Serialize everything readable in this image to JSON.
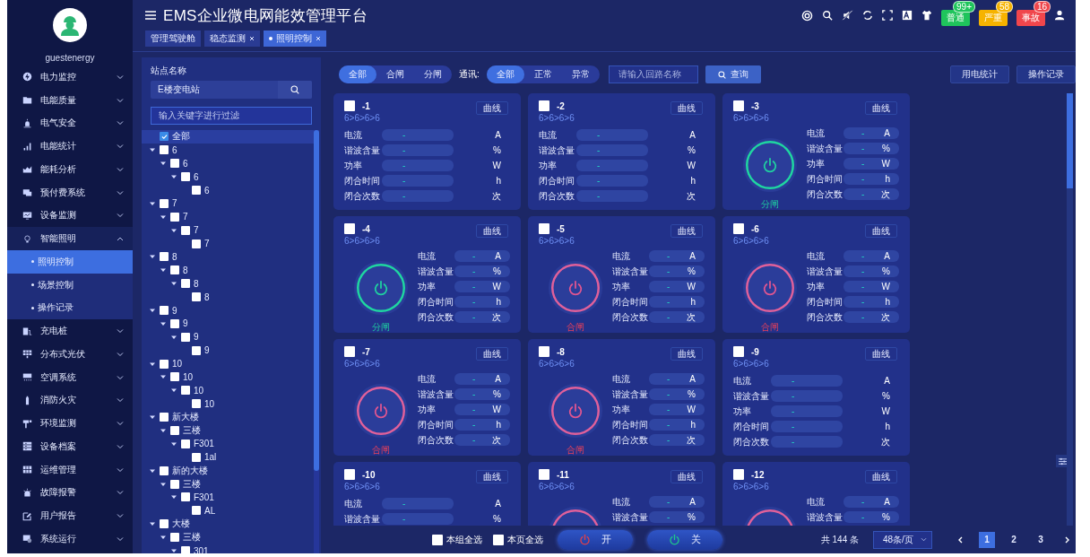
{
  "sidebar": {
    "username": "guestenergy",
    "items": [
      {
        "label": "电力监控",
        "expanded": false
      },
      {
        "label": "电能质量",
        "expanded": false
      },
      {
        "label": "电气安全",
        "expanded": false
      },
      {
        "label": "电能统计",
        "expanded": false
      },
      {
        "label": "能耗分析",
        "expanded": false
      },
      {
        "label": "预付费系统",
        "expanded": false
      },
      {
        "label": "设备监测",
        "expanded": false
      },
      {
        "label": "智能照明",
        "expanded": true,
        "children": [
          {
            "label": "照明控制",
            "selected": true
          },
          {
            "label": "场景控制",
            "selected": false
          },
          {
            "label": "操作记录",
            "selected": false
          }
        ]
      },
      {
        "label": "充电桩",
        "expanded": false
      },
      {
        "label": "分布式光伏",
        "expanded": false
      },
      {
        "label": "空调系统",
        "expanded": false
      },
      {
        "label": "消防火灾",
        "expanded": false
      },
      {
        "label": "环境监测",
        "expanded": false
      },
      {
        "label": "设备档案",
        "expanded": false
      },
      {
        "label": "运维管理",
        "expanded": false
      },
      {
        "label": "故障报警",
        "expanded": false
      },
      {
        "label": "用户报告",
        "expanded": false
      },
      {
        "label": "系统运行",
        "expanded": false
      }
    ]
  },
  "header": {
    "title": "EMS企业微电网能效管理平台",
    "alerts": [
      {
        "label": "普通",
        "count": "99+",
        "color": "#1fc45c"
      },
      {
        "label": "严重",
        "count": "58",
        "color": "#f6b300"
      },
      {
        "label": "事故",
        "count": "16",
        "color": "#f0464c"
      }
    ]
  },
  "tabs": [
    {
      "label": "管理驾驶舱",
      "selected": false,
      "closable": false
    },
    {
      "label": "稳态监测",
      "selected": false,
      "closable": true
    },
    {
      "label": "照明控制",
      "selected": true,
      "closable": true
    }
  ],
  "site_panel": {
    "label": "站点名称",
    "site": "E楼变电站",
    "filter_placeholder": "输入关键字进行过滤",
    "all": {
      "label": "全部",
      "checked": true
    },
    "tree": [
      {
        "label": "6",
        "checked": false,
        "expanded": true,
        "children": [
          {
            "label": "6",
            "checked": false,
            "expanded": true,
            "children": [
              {
                "label": "6",
                "checked": false,
                "expanded": true,
                "children": [
                  {
                    "label": "6",
                    "checked": false
                  }
                ]
              }
            ]
          }
        ]
      },
      {
        "label": "7",
        "checked": false,
        "expanded": true,
        "children": [
          {
            "label": "7",
            "checked": false,
            "expanded": true,
            "children": [
              {
                "label": "7",
                "checked": false,
                "expanded": true,
                "children": [
                  {
                    "label": "7",
                    "checked": false
                  }
                ]
              }
            ]
          }
        ]
      },
      {
        "label": "8",
        "checked": false,
        "expanded": true,
        "children": [
          {
            "label": "8",
            "checked": false,
            "expanded": true,
            "children": [
              {
                "label": "8",
                "checked": false,
                "expanded": true,
                "children": [
                  {
                    "label": "8",
                    "checked": false
                  }
                ]
              }
            ]
          }
        ]
      },
      {
        "label": "9",
        "checked": false,
        "expanded": true,
        "children": [
          {
            "label": "9",
            "checked": false,
            "expanded": true,
            "children": [
              {
                "label": "9",
                "checked": false,
                "expanded": true,
                "children": [
                  {
                    "label": "9",
                    "checked": false
                  }
                ]
              }
            ]
          }
        ]
      },
      {
        "label": "10",
        "checked": false,
        "expanded": true,
        "children": [
          {
            "label": "10",
            "checked": false,
            "expanded": true,
            "children": [
              {
                "label": "10",
                "checked": false,
                "expanded": true,
                "children": [
                  {
                    "label": "10",
                    "checked": false
                  }
                ]
              }
            ]
          }
        ]
      },
      {
        "label": "新大楼",
        "checked": false,
        "expanded": true,
        "children": [
          {
            "label": "三楼",
            "checked": false,
            "expanded": true,
            "children": [
              {
                "label": "F301",
                "checked": false,
                "expanded": true,
                "children": [
                  {
                    "label": "1al",
                    "checked": false
                  }
                ]
              }
            ]
          }
        ]
      },
      {
        "label": "新的大楼",
        "checked": false,
        "expanded": true,
        "children": [
          {
            "label": "三楼",
            "checked": false,
            "expanded": true,
            "children": [
              {
                "label": "F301",
                "checked": false,
                "expanded": true,
                "children": [
                  {
                    "label": "AL",
                    "checked": false
                  }
                ]
              }
            ]
          }
        ]
      },
      {
        "label": "大楼",
        "checked": false,
        "expanded": true,
        "children": [
          {
            "label": "三楼",
            "checked": false,
            "expanded": true,
            "children": [
              {
                "label": "301",
                "checked": false,
                "expanded": true
              }
            ]
          }
        ]
      }
    ]
  },
  "toolbar": {
    "state_filter": [
      {
        "label": "全部",
        "selected": true
      },
      {
        "label": "合闸",
        "selected": false
      },
      {
        "label": "分闸",
        "selected": false
      }
    ],
    "comm_label": "通讯:",
    "comm_filter": [
      {
        "label": "全部",
        "selected": true
      },
      {
        "label": "正常",
        "selected": false
      },
      {
        "label": "异常",
        "selected": false
      }
    ],
    "search_placeholder": "请输入回路名称",
    "search_button": "查询",
    "actions": [
      "用电统计",
      "操作记录"
    ]
  },
  "cards": [
    {
      "kind": "meter",
      "name": "-1",
      "checked": false,
      "path": "6>6>6>6",
      "curve": "曲线",
      "metrics": [
        {
          "label": "电流",
          "value": "-",
          "unit": "A"
        },
        {
          "label": "谐波含量",
          "value": "-",
          "unit": "%"
        },
        {
          "label": "功率",
          "value": "-",
          "unit": "W"
        },
        {
          "label": "闭合时间",
          "value": "-",
          "unit": "h"
        },
        {
          "label": "闭合次数",
          "value": "-",
          "unit": "次"
        }
      ]
    },
    {
      "kind": "meter",
      "name": "-2",
      "checked": false,
      "path": "6>6>6>6",
      "curve": "曲线",
      "metrics": [
        {
          "label": "电流",
          "value": "-",
          "unit": "A"
        },
        {
          "label": "谐波含量",
          "value": "-",
          "unit": "%"
        },
        {
          "label": "功率",
          "value": "-",
          "unit": "W"
        },
        {
          "label": "闭合时间",
          "value": "-",
          "unit": "h"
        },
        {
          "label": "闭合次数",
          "value": "-",
          "unit": "次"
        }
      ]
    },
    {
      "kind": "switch",
      "name": "-3",
      "checked": false,
      "path": "6>6>6>6",
      "curve": "曲线",
      "closed": false,
      "status": "分闸",
      "metrics": [
        {
          "label": "电流",
          "value": "-",
          "unit": "A"
        },
        {
          "label": "谐波含量",
          "value": "-",
          "unit": "%"
        },
        {
          "label": "功率",
          "value": "-",
          "unit": "W"
        },
        {
          "label": "闭合时间",
          "value": "-",
          "unit": "h"
        },
        {
          "label": "闭合次数",
          "value": "-",
          "unit": "次"
        }
      ]
    },
    {
      "kind": "switch",
      "name": "-4",
      "checked": false,
      "path": "6>6>6>6",
      "curve": "曲线",
      "closed": false,
      "status": "分闸",
      "metrics": [
        {
          "label": "电流",
          "value": "-",
          "unit": "A"
        },
        {
          "label": "谐波含量",
          "value": "-",
          "unit": "%"
        },
        {
          "label": "功率",
          "value": "-",
          "unit": "W"
        },
        {
          "label": "闭合时间",
          "value": "-",
          "unit": "h"
        },
        {
          "label": "闭合次数",
          "value": "-",
          "unit": "次"
        }
      ]
    },
    {
      "kind": "switch",
      "name": "-5",
      "checked": false,
      "path": "6>6>6>6",
      "curve": "曲线",
      "closed": true,
      "status": "合闸",
      "metrics": [
        {
          "label": "电流",
          "value": "-",
          "unit": "A"
        },
        {
          "label": "谐波含量",
          "value": "-",
          "unit": "%"
        },
        {
          "label": "功率",
          "value": "-",
          "unit": "W"
        },
        {
          "label": "闭合时间",
          "value": "-",
          "unit": "h"
        },
        {
          "label": "闭合次数",
          "value": "-",
          "unit": "次"
        }
      ]
    },
    {
      "kind": "switch",
      "name": "-6",
      "checked": false,
      "path": "6>6>6>6",
      "curve": "曲线",
      "closed": true,
      "status": "合闸",
      "metrics": [
        {
          "label": "电流",
          "value": "-",
          "unit": "A"
        },
        {
          "label": "谐波含量",
          "value": "-",
          "unit": "%"
        },
        {
          "label": "功率",
          "value": "-",
          "unit": "W"
        },
        {
          "label": "闭合时间",
          "value": "-",
          "unit": "h"
        },
        {
          "label": "闭合次数",
          "value": "-",
          "unit": "次"
        }
      ]
    },
    {
      "kind": "switch",
      "name": "-7",
      "checked": false,
      "path": "6>6>6>6",
      "curve": "曲线",
      "closed": true,
      "status": "合闸",
      "metrics": [
        {
          "label": "电流",
          "value": "-",
          "unit": "A"
        },
        {
          "label": "谐波含量",
          "value": "-",
          "unit": "%"
        },
        {
          "label": "功率",
          "value": "-",
          "unit": "W"
        },
        {
          "label": "闭合时间",
          "value": "-",
          "unit": "h"
        },
        {
          "label": "闭合次数",
          "value": "-",
          "unit": "次"
        }
      ]
    },
    {
      "kind": "switch",
      "name": "-8",
      "checked": false,
      "path": "6>6>6>6",
      "curve": "曲线",
      "closed": true,
      "status": "合闸",
      "metrics": [
        {
          "label": "电流",
          "value": "-",
          "unit": "A"
        },
        {
          "label": "谐波含量",
          "value": "-",
          "unit": "%"
        },
        {
          "label": "功率",
          "value": "-",
          "unit": "W"
        },
        {
          "label": "闭合时间",
          "value": "-",
          "unit": "h"
        },
        {
          "label": "闭合次数",
          "value": "-",
          "unit": "次"
        }
      ]
    },
    {
      "kind": "meter",
      "name": "-9",
      "checked": false,
      "path": "6>6>6>6",
      "curve": "曲线",
      "metrics": [
        {
          "label": "电流",
          "value": "-",
          "unit": "A"
        },
        {
          "label": "谐波含量",
          "value": "-",
          "unit": "%"
        },
        {
          "label": "功率",
          "value": "-",
          "unit": "W"
        },
        {
          "label": "闭合时间",
          "value": "-",
          "unit": "h"
        },
        {
          "label": "闭合次数",
          "value": "-",
          "unit": "次"
        }
      ]
    },
    {
      "kind": "meter",
      "name": "-10",
      "checked": false,
      "path": "6>6>6>6",
      "curve": "曲线",
      "metrics": [
        {
          "label": "电流",
          "value": "-",
          "unit": "A"
        },
        {
          "label": "谐波含量",
          "value": "-",
          "unit": "%"
        }
      ]
    },
    {
      "kind": "switch",
      "name": "-11",
      "checked": false,
      "path": "6>6>6>6",
      "curve": "曲线",
      "closed": true,
      "metrics": [
        {
          "label": "电流",
          "value": "-",
          "unit": "A"
        },
        {
          "label": "谐波含量",
          "value": "-",
          "unit": "%"
        }
      ]
    },
    {
      "kind": "switch",
      "name": "-12",
      "checked": false,
      "path": "6>6>6>6",
      "curve": "曲线",
      "closed": true,
      "metrics": [
        {
          "label": "电流",
          "value": "-",
          "unit": "A"
        },
        {
          "label": "谐波含量",
          "value": "-",
          "unit": "%"
        }
      ]
    }
  ],
  "footer": {
    "select_group": {
      "label": "本组全选",
      "checked": false
    },
    "select_page": {
      "label": "本页全选",
      "checked": false
    },
    "on_button": "开",
    "off_button": "关",
    "total": "共 144 条",
    "page_size": "48条/页",
    "pages": [
      {
        "label": "1",
        "selected": true
      },
      {
        "label": "2",
        "selected": false
      },
      {
        "label": "3",
        "selected": false
      }
    ]
  }
}
